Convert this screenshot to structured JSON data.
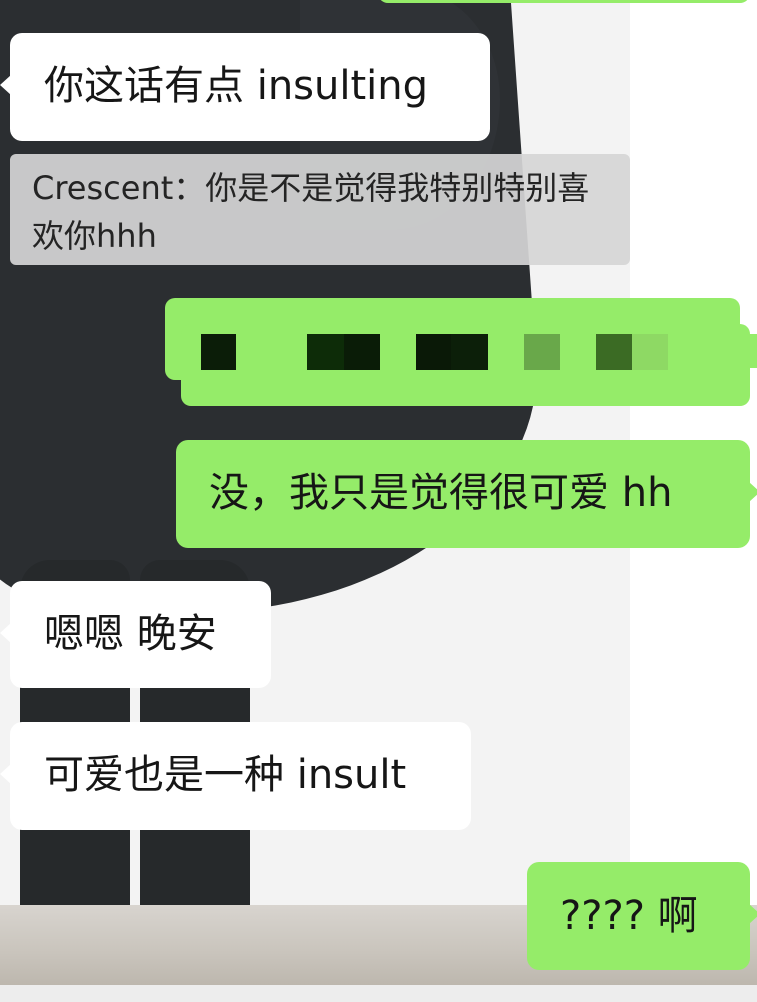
{
  "messages": {
    "m1": "你这话有点 insulting",
    "quote": "Crescent：你是不是觉得我特别特别喜欢你hhh",
    "m3": "没，我只是觉得很可爱 hh",
    "m4": "嗯嗯 晚安",
    "m5": "可爱也是一种 insult",
    "m6": "???? 啊"
  },
  "colors": {
    "bubble_incoming": "#ffffff",
    "bubble_outgoing": "#95ec69",
    "quote_background": "#d6d6d6"
  }
}
